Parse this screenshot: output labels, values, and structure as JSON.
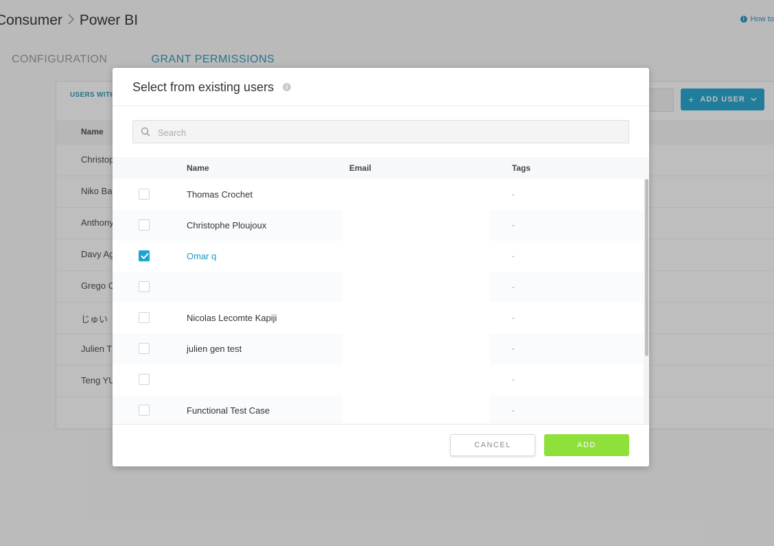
{
  "breadcrumb": {
    "parent": "Consumer",
    "current": "Power BI"
  },
  "help_link": "How to",
  "tabs": [
    {
      "label": "CONFIGURATION",
      "active": false
    },
    {
      "label": "GRANT PERMISSIONS",
      "active": true
    }
  ],
  "card": {
    "title": "USERS WITH",
    "add_user_label": "ADD USER",
    "name_header": "Name",
    "rows": [
      "Christop",
      "Niko Ba",
      "Anthony",
      "Davy Ag",
      "Grego C",
      "じゅい",
      "Julien T",
      "Teng YU"
    ]
  },
  "modal": {
    "title": "Select from existing users",
    "search_placeholder": "Search",
    "columns": {
      "name": "Name",
      "email": "Email",
      "tags": "Tags"
    },
    "users": [
      {
        "name": "Thomas Crochet",
        "tags": "-",
        "checked": false
      },
      {
        "name": "Christophe Ploujoux",
        "tags": "-",
        "checked": false
      },
      {
        "name": "Omar q",
        "tags": "-",
        "checked": true
      },
      {
        "name": "",
        "tags": "-",
        "checked": false
      },
      {
        "name": "Nicolas Lecomte Kapiji",
        "tags": "-",
        "checked": false
      },
      {
        "name": "julien gen test",
        "tags": "-",
        "checked": false
      },
      {
        "name": "",
        "tags": "-",
        "checked": false
      },
      {
        "name": "Functional Test Case",
        "tags": "-",
        "checked": false
      }
    ],
    "cancel_label": "CANCEL",
    "add_label": "ADD"
  },
  "colors": {
    "accent": "#1fa2cf",
    "add_button": "#8fe03a",
    "overlay": "rgba(40,40,40,0.30)"
  }
}
